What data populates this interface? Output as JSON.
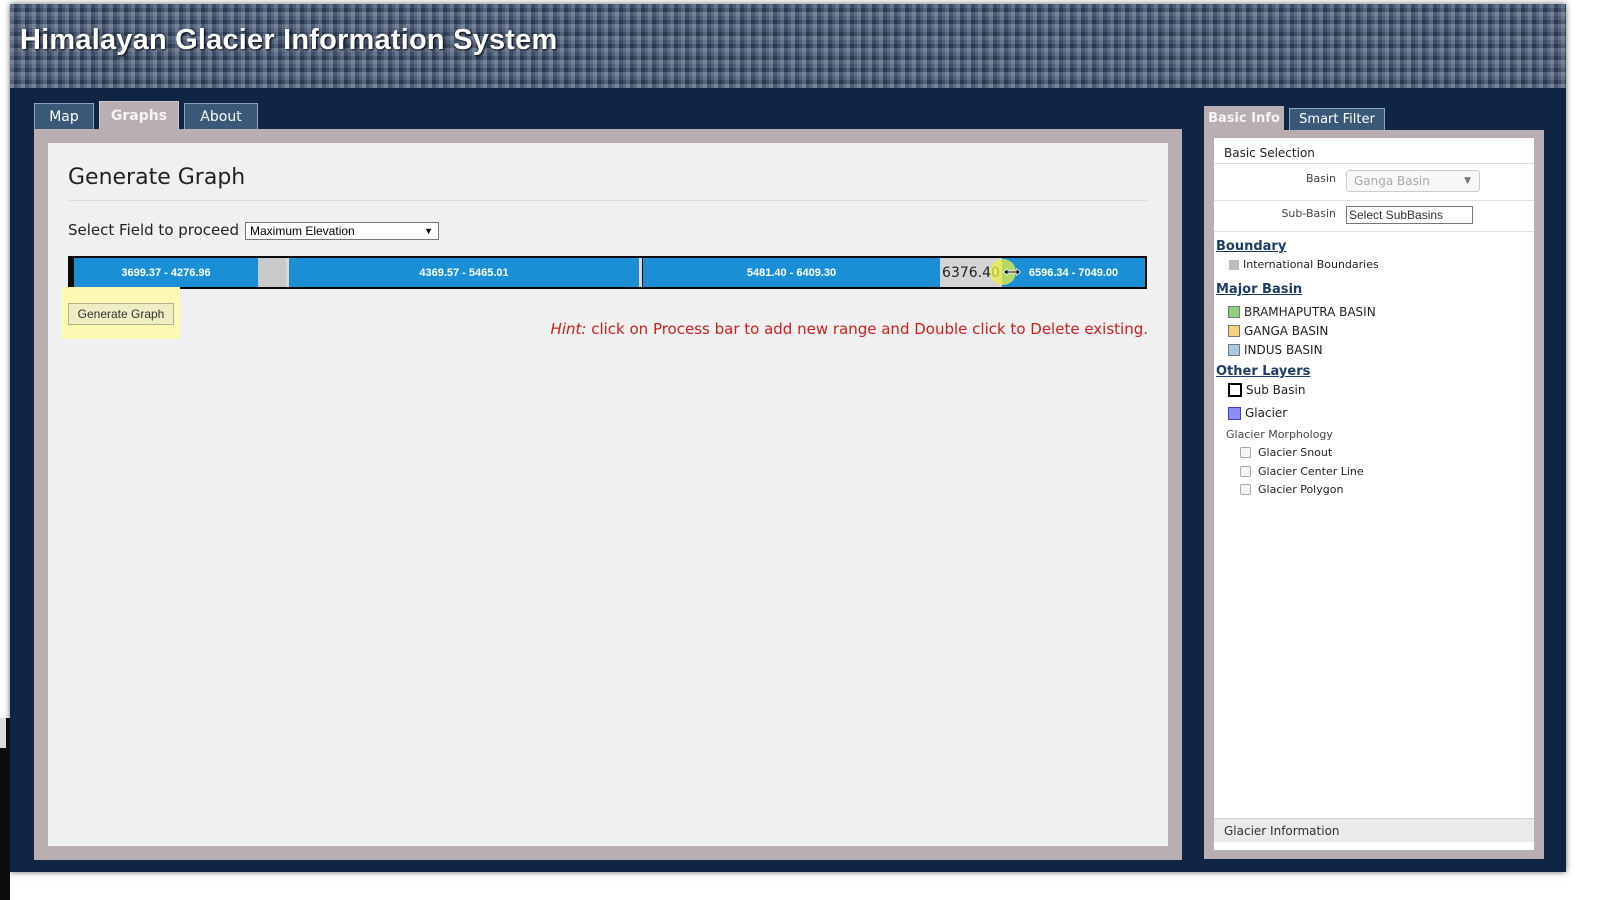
{
  "header": {
    "title": "Himalayan Glacier Information System"
  },
  "tabs": [
    {
      "label": "Map"
    },
    {
      "label": "Graphs"
    },
    {
      "label": "About"
    }
  ],
  "main": {
    "title": "Generate Graph",
    "field_label": "Select Field to proceed :",
    "field_select_value": "Maximum Elevation",
    "ranges": [
      {
        "label": "3699.37 - 4276.96"
      },
      {
        "label": "4369.57 - 5465.01"
      },
      {
        "label": "5481.40 - 6409.30"
      },
      {
        "label": "6596.34 - 7049.00"
      }
    ],
    "drag_value": "6376.40",
    "generate_button": "Generate Graph",
    "hint_prefix": "Hint:",
    "hint_text": " click on Process bar to add new range and Double click to Delete existing."
  },
  "side": {
    "tabs": [
      {
        "label": "Basic Info"
      },
      {
        "label": "Smart Filter"
      }
    ],
    "basic_selection": "Basic Selection",
    "basin_label": "Basin",
    "basin_value": "Ganga Basin",
    "subbasin_label": "Sub-Basin",
    "subbasin_placeholder": "Select SubBasins",
    "boundary_head": "Boundary",
    "international_boundaries": "International Boundaries",
    "major_basin_head": "Major Basin",
    "basins": [
      {
        "label": "BRAMHAPUTRA BASIN",
        "color": "#8fcf7d"
      },
      {
        "label": "GANGA BASIN",
        "color": "#f5d27a"
      },
      {
        "label": "INDUS BASIN",
        "color": "#a6c8e6"
      }
    ],
    "other_layers_head": "Other Layers",
    "sub_basin": "Sub Basin",
    "glacier": "Glacier",
    "glacier_morphology": "Glacier Morphology",
    "morphology_items": [
      {
        "label": "Glacier Snout"
      },
      {
        "label": "Glacier Center Line"
      },
      {
        "label": "Glacier Polygon"
      }
    ],
    "glacier_information": "Glacier Information"
  },
  "colors": {
    "background": "#102543",
    "range_bar": "#1a8fd6",
    "hint": "#d11f1f"
  }
}
